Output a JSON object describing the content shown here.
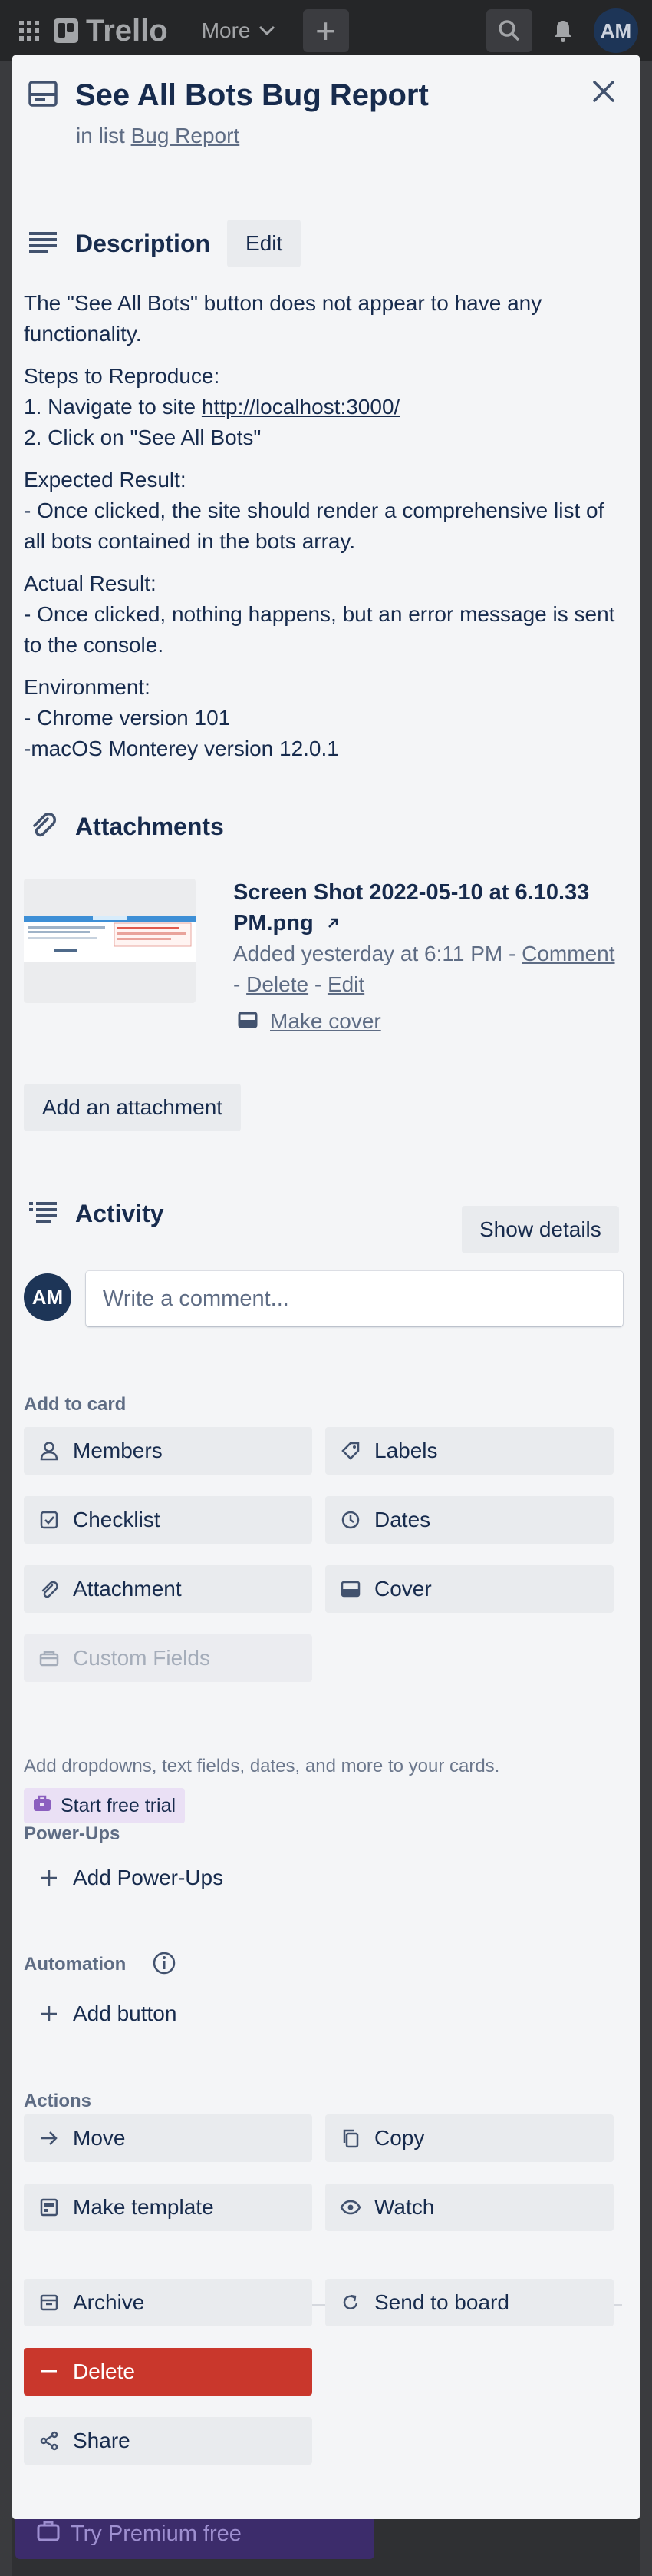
{
  "app": {
    "logo_text": "Trello",
    "more_label": "More",
    "avatar_initials": "AM",
    "premium_label": "Try Premium free"
  },
  "card": {
    "title": "See All Bots Bug Report",
    "in_list_prefix": "in list",
    "list_name": "Bug Report"
  },
  "description": {
    "heading": "Description",
    "edit_label": "Edit",
    "paragraphs": [
      [
        "The \"See All Bots\" button does not appear to have any functionality."
      ],
      [
        "Steps to Reproduce:"
      ],
      [
        "Expected Result:",
        "- Once clicked, the site should render a comprehensive list of all bots contained in the bots array."
      ],
      [
        "Actual Result:",
        "- Once clicked, nothing happens, but an error message is sent to the console."
      ],
      [
        "Environment:",
        "- Chrome version 101",
        "-macOS Monterey version 12.0.1"
      ]
    ],
    "step1_prefix": "1. Navigate to site ",
    "step1_link": "http://localhost:3000/",
    "step2": "2. Click on \"See All Bots\""
  },
  "attachments": {
    "heading": "Attachments",
    "items": [
      {
        "name": "Screen Shot 2022-05-10 at 6.10.33 PM.png",
        "added": "Added yesterday at 6:11 PM",
        "comment_label": "Comment",
        "delete_label": "Delete",
        "edit_label": "Edit",
        "make_cover_label": "Make cover"
      }
    ],
    "add_label": "Add an attachment"
  },
  "activity": {
    "heading": "Activity",
    "show_details_label": "Show details",
    "avatar_initials": "AM",
    "comment_placeholder": "Write a comment..."
  },
  "sidebar": {
    "add_to_card_label": "Add to card",
    "members_label": "Members",
    "labels_label": "Labels",
    "checklist_label": "Checklist",
    "dates_label": "Dates",
    "attachment_label": "Attachment",
    "cover_label": "Cover",
    "custom_fields_label": "Custom Fields",
    "custom_fields_hint": "Add dropdowns, text fields, dates, and more to your cards.",
    "trial_label": "Start free trial",
    "powerups_label": "Power-Ups",
    "add_powerups_label": "Add Power-Ups",
    "automation_label": "Automation",
    "add_button_label": "Add button",
    "actions_label": "Actions",
    "move_label": "Move",
    "copy_label": "Copy",
    "make_template_label": "Make template",
    "watch_label": "Watch",
    "archive_label": "Archive",
    "send_to_board_label": "Send to board",
    "delete_label": "Delete",
    "share_label": "Share"
  },
  "colors": {
    "modal_bg": "#f4f5f7",
    "text": "#172b4d",
    "muted": "#5e6c84",
    "danger": "#c9372c",
    "avatar": "#1d3557",
    "trial_bg": "#eae0f5"
  }
}
